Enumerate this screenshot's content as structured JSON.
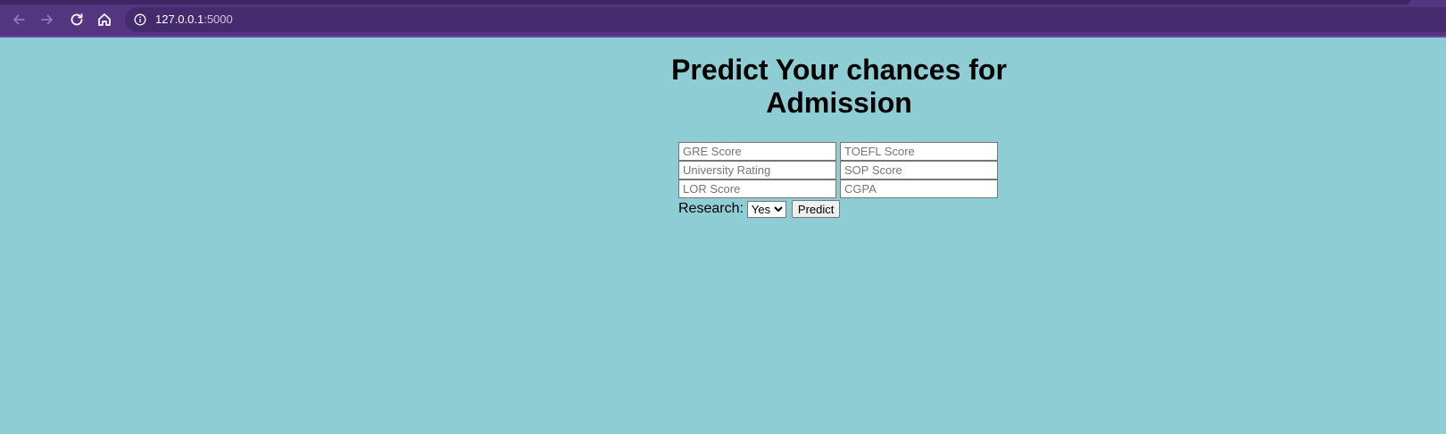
{
  "browser": {
    "url_host": "127.0.0.1",
    "url_port": ":5000",
    "colors": {
      "toolbar": "#533580",
      "omnibox": "#452a6d",
      "page_bg": "#8fcdd4"
    },
    "icons": [
      "back-arrow-icon",
      "forward-arrow-icon",
      "reload-icon",
      "home-icon",
      "info-icon"
    ]
  },
  "page": {
    "title": "Predict Your chances for Admission",
    "fields": {
      "gre": {
        "placeholder": "GRE Score",
        "value": ""
      },
      "toefl": {
        "placeholder": "TOEFL Score",
        "value": ""
      },
      "university": {
        "placeholder": "University Rating",
        "value": ""
      },
      "sop": {
        "placeholder": "SOP Score",
        "value": ""
      },
      "lor": {
        "placeholder": "LOR Score",
        "value": ""
      },
      "cgpa": {
        "placeholder": "CGPA",
        "value": ""
      }
    },
    "research_label": "Research:",
    "research_selected": "Yes",
    "predict_label": "Predict"
  }
}
